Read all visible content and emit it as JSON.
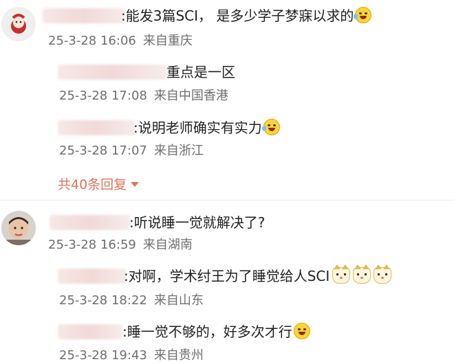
{
  "comments": [
    {
      "text": ":能发3篇SCI， 是多少学子梦寐以求的",
      "time": "25-3-28 16:06",
      "location": "来自重庆",
      "replies": [
        {
          "text": "重点是一区",
          "time": "25-3-28 17:08",
          "location": "来自中国香港"
        },
        {
          "text": ":说明老师确实有实力",
          "time": "25-3-28 17:07",
          "location": "来自浙江"
        }
      ],
      "reply_count_label": "共40条回复"
    },
    {
      "text": ":听说睡一觉就解决了?",
      "time": "25-3-28 16:59",
      "location": "来自湖南",
      "replies": [
        {
          "text": ":对啊，学术纣王为了睡觉给人SCI",
          "time": "25-3-28 18:22",
          "location": "来自山东"
        },
        {
          "text": ":睡一觉不够的，好多次才行",
          "time": "25-3-28 19:43",
          "location": "来自贵州"
        }
      ]
    }
  ],
  "icons": {
    "laugh_cry": "laugh-cry-emoji",
    "laugh": "laugh-emoji",
    "cat": "cat-emoji"
  },
  "colors": {
    "accent": "#e0735e",
    "meta": "#6e6e6e"
  }
}
